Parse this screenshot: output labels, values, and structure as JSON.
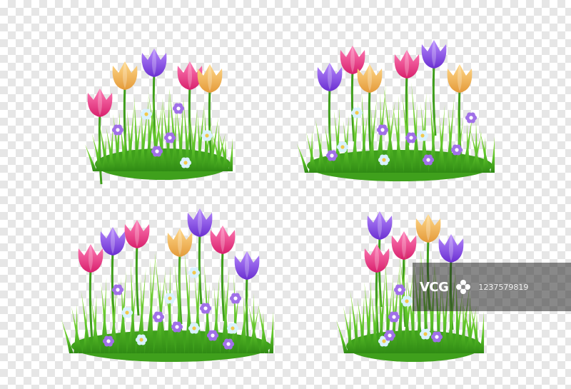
{
  "scene": {
    "description_free": true,
    "background": "checkerboard-transparency",
    "checker_colors": [
      "#ffffff",
      "#e6e6e6"
    ]
  },
  "colors": {
    "grass_dark": "#3a9a1a",
    "grass_mid": "#5cc22a",
    "grass_light": "#9be24a",
    "tulip_pink": "#f0408a",
    "tulip_purple": "#8a4ee0",
    "tulip_yellow": "#f2b84a",
    "daisy_purple": "#a070e8",
    "daisy_blue": "#d8f2ff"
  },
  "watermark": {
    "logo_text": "VCG",
    "id_text": "1237579819"
  }
}
